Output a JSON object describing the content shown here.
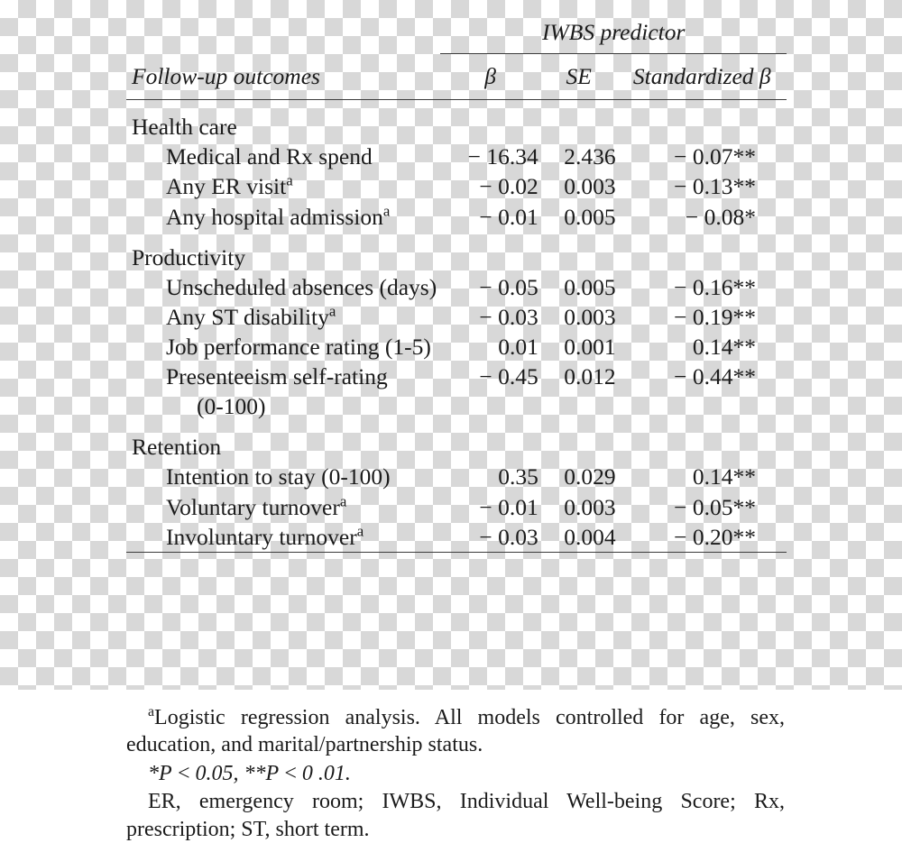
{
  "table": {
    "spanner_header": "IWBS predictor",
    "columns": {
      "outcome": "Follow-up outcomes",
      "beta": "β",
      "se": "SE",
      "standardized_beta": "Standardized β"
    },
    "groups": [
      {
        "name": "Health care",
        "rows": [
          {
            "label": "Medical and Rx spend",
            "sup": "",
            "beta": "− 16.34",
            "se": "2.436",
            "std": "− 0.07**"
          },
          {
            "label": "Any ER visit",
            "sup": "a",
            "beta": "− 0.02",
            "se": "0.003",
            "std": "− 0.13**"
          },
          {
            "label": "Any hospital admission",
            "sup": "a",
            "beta": "− 0.01",
            "se": "0.005",
            "std": "− 0.08*"
          }
        ]
      },
      {
        "name": "Productivity",
        "rows": [
          {
            "label": "Unscheduled absences (days)",
            "sup": "",
            "beta": "− 0.05",
            "se": "0.005",
            "std": "− 0.16**"
          },
          {
            "label": "Any ST disability",
            "sup": "a",
            "beta": "− 0.03",
            "se": "0.003",
            "std": "− 0.19**"
          },
          {
            "label": "Job performance rating (1-5)",
            "sup": "",
            "beta": "0.01",
            "se": "0.001",
            "std": "0.14**"
          },
          {
            "label": "Presenteeism self-rating",
            "sup": "",
            "label2": "(0-100)",
            "beta": "− 0.45",
            "se": "0.012",
            "std": "− 0.44**"
          }
        ]
      },
      {
        "name": "Retention",
        "rows": [
          {
            "label": "Intention to stay (0-100)",
            "sup": "",
            "beta": "0.35",
            "se": "0.029",
            "std": "0.14**"
          },
          {
            "label": "Voluntary turnover",
            "sup": "a",
            "beta": "− 0.01",
            "se": "0.003",
            "std": "− 0.05**"
          },
          {
            "label": "Involuntary turnover",
            "sup": "a",
            "beta": "− 0.03",
            "se": "0.004",
            "std": "− 0.20**"
          }
        ]
      }
    ]
  },
  "notes": {
    "footnote_marker": "a",
    "footnote_a": "Logistic regression analysis. All models controlled for age, sex, education, and marital/partnership status.",
    "significance": "*P < 0.05, **P < 0 .01.",
    "abbreviations": "ER, emergency room; IWBS, Individual Well-being Score; Rx, prescription; ST, short term."
  }
}
